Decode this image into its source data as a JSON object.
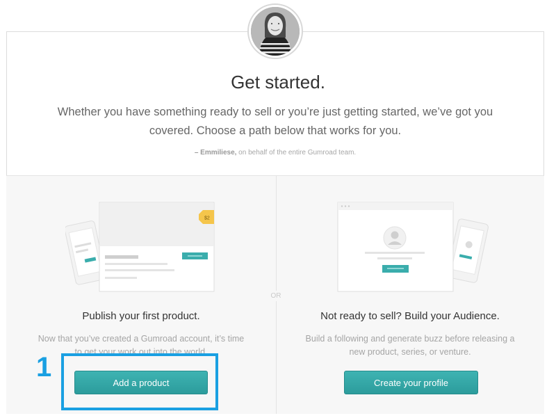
{
  "header": {
    "title": "Get started.",
    "intro": "Whether you have something ready to sell or you’re just getting started, we’ve got you covered. Choose a path below that works for you.",
    "signature_name": "– Emmiliese,",
    "signature_rest": " on behalf of the entire Gumroad team."
  },
  "or_label": "OR",
  "left": {
    "price_tag": "$2",
    "title": "Publish your first product.",
    "description": "Now that you’ve created a Gumroad account, it’s time to get your work out into the world.",
    "button": "Add a product"
  },
  "right": {
    "title": "Not ready to sell? Build your Audience.",
    "description": "Build a following and generate buzz before releasing a new product, series, or venture.",
    "button": "Create your profile"
  },
  "annotation": {
    "step_number": "1",
    "color": "#1aa0e2"
  },
  "colors": {
    "accent": "#36a8a8",
    "annotation": "#1aa0e2"
  }
}
